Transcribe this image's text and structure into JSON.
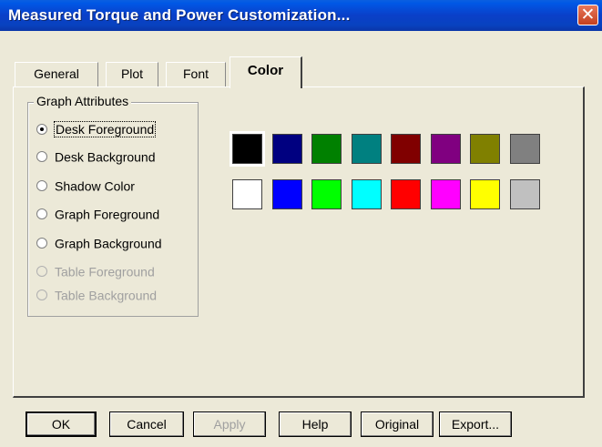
{
  "window": {
    "title": "Measured Torque and Power Customization...",
    "close_label": "✕"
  },
  "tabs": [
    {
      "label": "General",
      "active": false
    },
    {
      "label": "Plot",
      "active": false
    },
    {
      "label": "Font",
      "active": false
    },
    {
      "label": "Color",
      "active": true
    }
  ],
  "group": {
    "title": "Graph Attributes",
    "options": [
      {
        "label": "Desk Foreground",
        "checked": true,
        "enabled": true
      },
      {
        "label": "Desk Background",
        "checked": false,
        "enabled": true
      },
      {
        "label": "Shadow Color",
        "checked": false,
        "enabled": true
      },
      {
        "label": "Graph Foreground",
        "checked": false,
        "enabled": true
      },
      {
        "label": "Graph Background",
        "checked": false,
        "enabled": true
      },
      {
        "label": "Table Foreground",
        "checked": false,
        "enabled": false
      },
      {
        "label": "Table Background",
        "checked": false,
        "enabled": false
      }
    ]
  },
  "palette": {
    "row1": [
      "#000000",
      "#000080",
      "#008000",
      "#008080",
      "#800000",
      "#800080",
      "#808000",
      "#808080"
    ],
    "row2": [
      "#ffffff",
      "#0000ff",
      "#00ff00",
      "#00ffff",
      "#ff0000",
      "#ff00ff",
      "#ffff00",
      "#c0c0c0"
    ],
    "selected": "#000000"
  },
  "buttons": {
    "ok": "OK",
    "cancel": "Cancel",
    "apply": "Apply",
    "help": "Help",
    "original": "Original",
    "export": "Export..."
  }
}
